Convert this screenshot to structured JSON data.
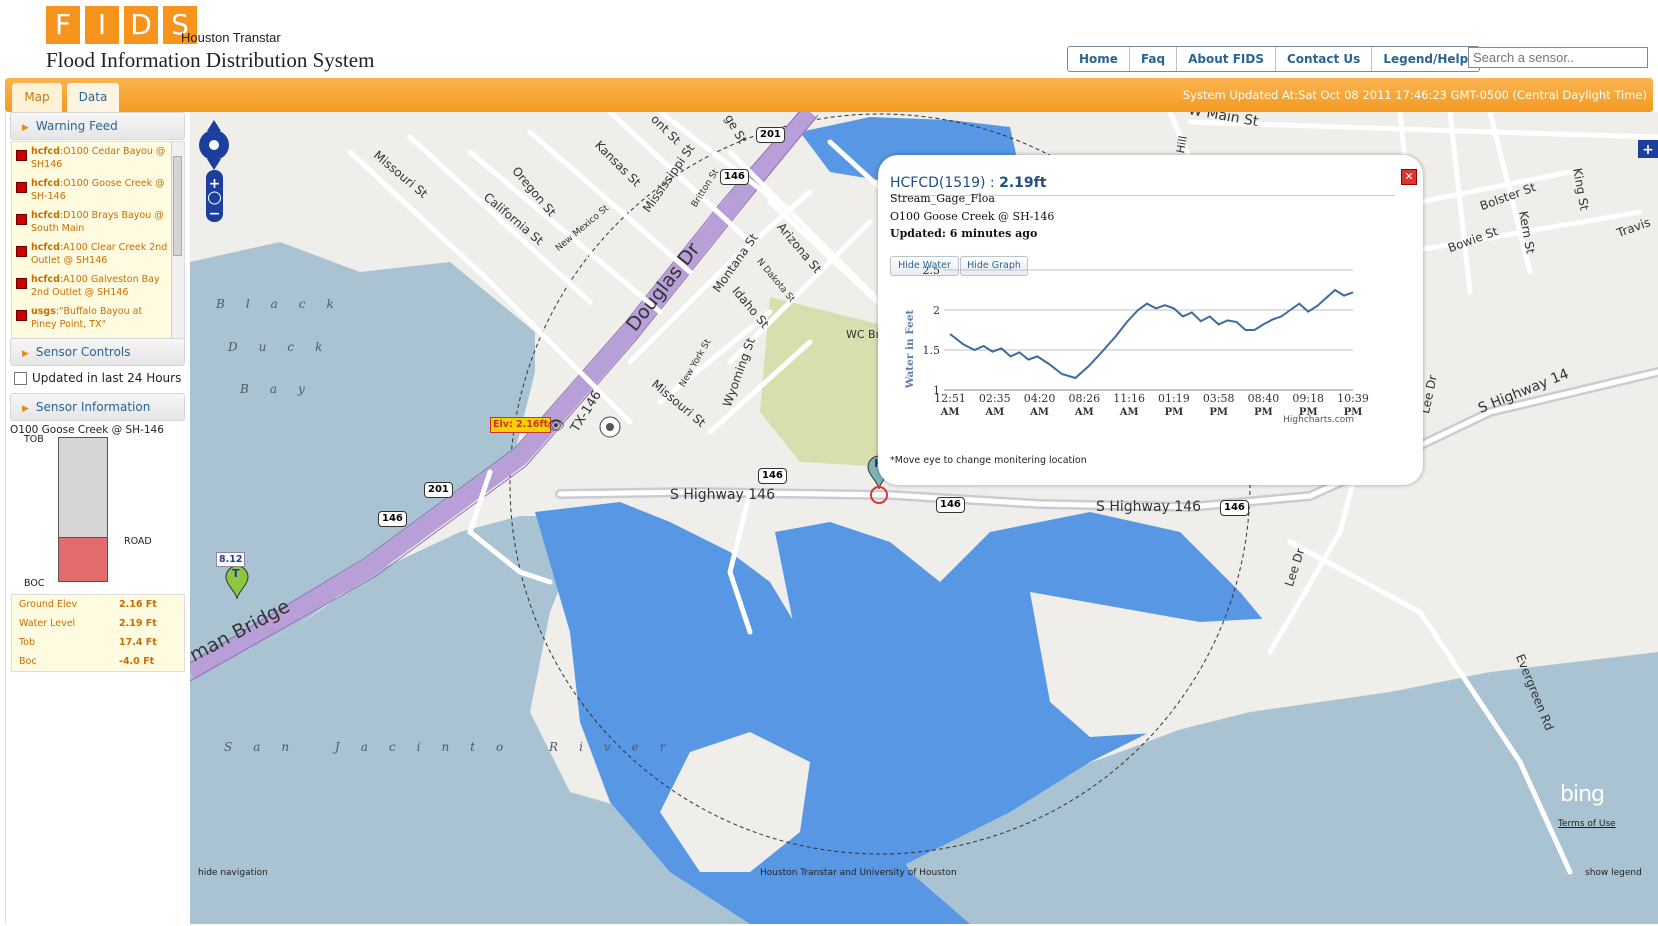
{
  "app": {
    "logo_letters": [
      "F",
      "I",
      "D",
      "S"
    ],
    "brand_sub": "Houston Transtar",
    "brand_title": "Flood Information Distribution System"
  },
  "nav": {
    "links": [
      "Home",
      "Faq",
      "About FIDS",
      "Contact Us",
      "Legend/Help"
    ],
    "search_placeholder": "Search a sensor.."
  },
  "toolbar": {
    "tabs": [
      "Map",
      "Data"
    ],
    "status": "System Updated At:Sat Oct 08 2011 17:46:23 GMT-0500 (Central Daylight Time)"
  },
  "sidebar": {
    "warning_feed": "Warning Feed",
    "warnings": [
      {
        "source": "hcfcd",
        "text": ":O100 Cedar Bayou @ SH146"
      },
      {
        "source": "hcfcd",
        "text": ":O100 Goose Creek @ SH-146"
      },
      {
        "source": "hcfcd",
        "text": ":D100 Brays Bayou @ South Main"
      },
      {
        "source": "hcfcd",
        "text": ":A100 Clear Creek 2nd Outlet @ SH146"
      },
      {
        "source": "hcfcd",
        "text": ":A100 Galveston Bay 2nd Outlet @ SH146"
      },
      {
        "source": "usgs",
        "text": ":\"Buffalo Bayou at Piney Point, TX\""
      }
    ],
    "sensor_controls": "Sensor Controls",
    "updated_24h": "Updated in last 24 Hours",
    "sensor_information": "Sensor Information",
    "gauge": {
      "title": "O100 Goose Creek @ SH-146",
      "tob": "TOB",
      "road": "ROAD",
      "boc": "BOC",
      "water_fill_fraction": 0.3
    },
    "info_rows": [
      {
        "label": "Ground Elev",
        "value": "2.16 Ft"
      },
      {
        "label": "Water Level",
        "value": "2.19 Ft"
      },
      {
        "label": "Tob",
        "value": "17.4 Ft"
      },
      {
        "label": "Boc",
        "value": "-4.0 Ft"
      }
    ]
  },
  "map": {
    "labels": {
      "black": "Black",
      "duck": "Duck",
      "bay": "Bay",
      "river": "San Jacinto River",
      "douglas": "Douglas Dr",
      "bridge": "man Bridge",
      "highway_mid": "S Highway 146",
      "highway_right": "S Highway 146",
      "highway_far": "S Highway 14",
      "tx146": "TX-146",
      "main_st": "W Main St",
      "missouri1": "Missouri St",
      "missouri2": "Missouri St",
      "oregon": "Oregon St",
      "california": "California St",
      "kansas": "Kansas St",
      "mississippi": "Mississippi St",
      "newmexico": "New Mexico St",
      "britton": "Britton St",
      "montana": "Montana St",
      "arizona": "Arizona St",
      "ndakota": "N Dakota St",
      "idaho": "Idaho St",
      "newyork": "New York St",
      "wyoming": "Wyoming St",
      "wc": "WC Br",
      "bolster": "Bolster St",
      "bowie": "Bowie St",
      "kern": "Kern St",
      "king": "King St",
      "travis": "Travis",
      "lee1": "Lee Dr",
      "lee2": "Lee Dr",
      "evergreen": "Evergreen Rd",
      "ont": "ont St",
      "ge": "ge St",
      "hill": "Hill"
    },
    "shields": [
      "201",
      "146",
      "146",
      "201",
      "146",
      "146",
      "146"
    ],
    "elevation_label": "Elv: 2.16ft",
    "marker_t_value": "8.12",
    "marker_t": "T",
    "marker_h": "H",
    "bing": "bing",
    "terms": "Terms of Use",
    "footer_left": "hide navigation",
    "footer_mid": "Houston Transtar and University of Houston",
    "footer_right": "show legend"
  },
  "popup": {
    "title": "HCFCD(1519) : ",
    "value": "2.19ft",
    "type": "Stream_Gage_Floa",
    "site": "O100 Goose Creek @ SH-146",
    "updated": "Updated: 6 minutes ago",
    "hide_water": "Hide Water",
    "hide_graph": "Hide Graph",
    "footnote": "*Move eye to change monitering location",
    "credit": "Highcharts.com"
  },
  "chart_data": {
    "type": "line",
    "ylabel": "Water in Feet",
    "ylim": [
      1,
      2.5
    ],
    "yticks": [
      "2.5",
      "2",
      "1.5",
      "1"
    ],
    "xticks": [
      [
        "12:51",
        "AM"
      ],
      [
        "02:35",
        "AM"
      ],
      [
        "04:20",
        "AM"
      ],
      [
        "08:26",
        "AM"
      ],
      [
        "11:16",
        "AM"
      ],
      [
        "01:19",
        "PM"
      ],
      [
        "03:58",
        "PM"
      ],
      [
        "08:40",
        "PM"
      ],
      [
        "09:18",
        "PM"
      ],
      [
        "10:39",
        "PM"
      ]
    ],
    "x": [
      0,
      0.3,
      0.55,
      0.75,
      0.95,
      1.15,
      1.35,
      1.55,
      1.75,
      1.95,
      2.2,
      2.5,
      2.8,
      3.1,
      3.4,
      3.7,
      3.95,
      4.2,
      4.4,
      4.6,
      4.8,
      5.0,
      5.2,
      5.4,
      5.6,
      5.8,
      6.0,
      6.2,
      6.4,
      6.6,
      6.8,
      7.0,
      7.2,
      7.4,
      7.6,
      7.8,
      8.0,
      8.2,
      8.4,
      8.6,
      8.8,
      9.0
    ],
    "values": [
      1.7,
      1.57,
      1.5,
      1.55,
      1.48,
      1.52,
      1.42,
      1.47,
      1.38,
      1.42,
      1.33,
      1.2,
      1.15,
      1.3,
      1.48,
      1.67,
      1.85,
      2.0,
      2.08,
      2.02,
      2.06,
      2.02,
      1.92,
      1.97,
      1.86,
      1.92,
      1.82,
      1.87,
      1.85,
      1.75,
      1.75,
      1.82,
      1.88,
      1.92,
      2.0,
      2.08,
      1.98,
      2.05,
      2.15,
      2.25,
      2.18,
      2.22
    ]
  },
  "colors": {
    "accent": "#f7941d",
    "link": "#2a6496",
    "water": "#5897e3",
    "bay": "#a9c3d3",
    "highway": "#b99fd8",
    "park": "#d7dfae",
    "gauge_water": "#e46b6b"
  }
}
